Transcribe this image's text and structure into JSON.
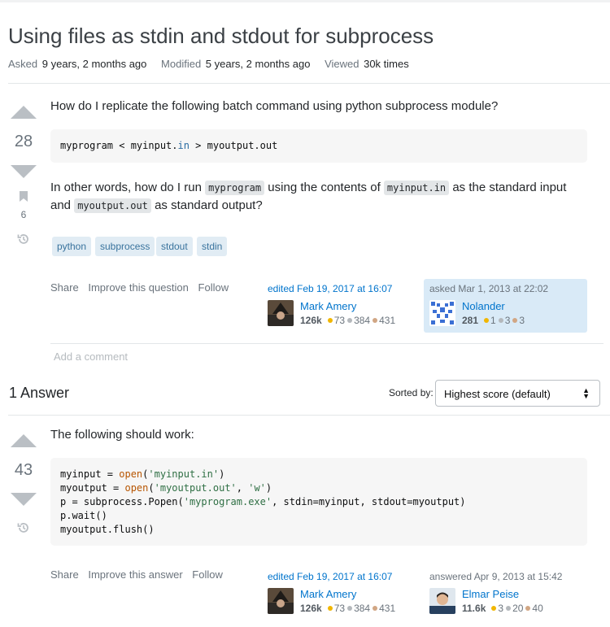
{
  "question": {
    "title": "Using files as stdin and stdout for subprocess",
    "meta": {
      "asked_label": "Asked",
      "asked_value": "9 years, 2 months ago",
      "modified_label": "Modified",
      "modified_value": "5 years, 2 months ago",
      "viewed_label": "Viewed",
      "viewed_value": "30k times"
    },
    "score": "28",
    "bookmark_count": "6",
    "body_p1": "How do I replicate the following batch command using python subprocess module?",
    "code": {
      "part1": "myprogram < myinput.",
      "part2": "in",
      "part3": " > myoutput.out"
    },
    "body_p2": {
      "t1": "In other words, how do I run ",
      "c1": "myprogram",
      "t2": " using the contents of ",
      "c2": "myinput.in",
      "t3": " as the standard input",
      "t4": "and ",
      "c3": "myoutput.out",
      "t5": " as standard output?"
    },
    "tags": [
      "python",
      "subprocess",
      "stdout",
      "stdin"
    ],
    "menu": {
      "share": "Share",
      "improve": "Improve this question",
      "follow": "Follow"
    },
    "edited": {
      "when": "edited Feb 19, 2017 at 16:07",
      "user": "Mark Amery",
      "rep": "126k",
      "gold": "73",
      "silver": "384",
      "bronze": "431"
    },
    "owner": {
      "when": "asked Mar 1, 2013 at 22:02",
      "user": "Nolander",
      "rep": "281",
      "gold": "1",
      "silver": "3",
      "bronze": "3"
    },
    "add_comment": "Add a comment"
  },
  "answers_header": {
    "count_label": "1 Answer",
    "sorted_label": "Sorted by:",
    "sorted_value": "Highest score (default)"
  },
  "answer": {
    "score": "43",
    "body_p1": "The following should work:",
    "code": {
      "l1_a": "myinput = ",
      "l1_b": "open",
      "l1_c": "(",
      "l1_d": "'myinput.in'",
      "l1_e": ")",
      "l2_a": "myoutput = ",
      "l2_b": "open",
      "l2_c": "(",
      "l2_d": "'myoutput.out'",
      "l2_e": ", ",
      "l2_f": "'w'",
      "l2_g": ")",
      "l3_a": "p = subprocess.Popen(",
      "l3_b": "'myprogram.exe'",
      "l3_c": ", stdin=myinput, stdout=myoutput)",
      "l4": "p.wait()",
      "l5": "myoutput.flush()"
    },
    "menu": {
      "share": "Share",
      "improve": "Improve this answer",
      "follow": "Follow"
    },
    "edited": {
      "when": "edited Feb 19, 2017 at 16:07",
      "user": "Mark Amery",
      "rep": "126k",
      "gold": "73",
      "silver": "384",
      "bronze": "431"
    },
    "owner": {
      "when": "answered Apr 9, 2013 at 15:42",
      "user": "Elmar Peise",
      "rep": "11.6k",
      "gold": "3",
      "silver": "20",
      "bronze": "40"
    }
  },
  "colors": {
    "link": "#0074cc",
    "tag_bg": "#e1ecf4",
    "tag_text": "#39739d",
    "owner_card_bg": "#d9eaf7",
    "code_bg": "#f6f6f6"
  }
}
